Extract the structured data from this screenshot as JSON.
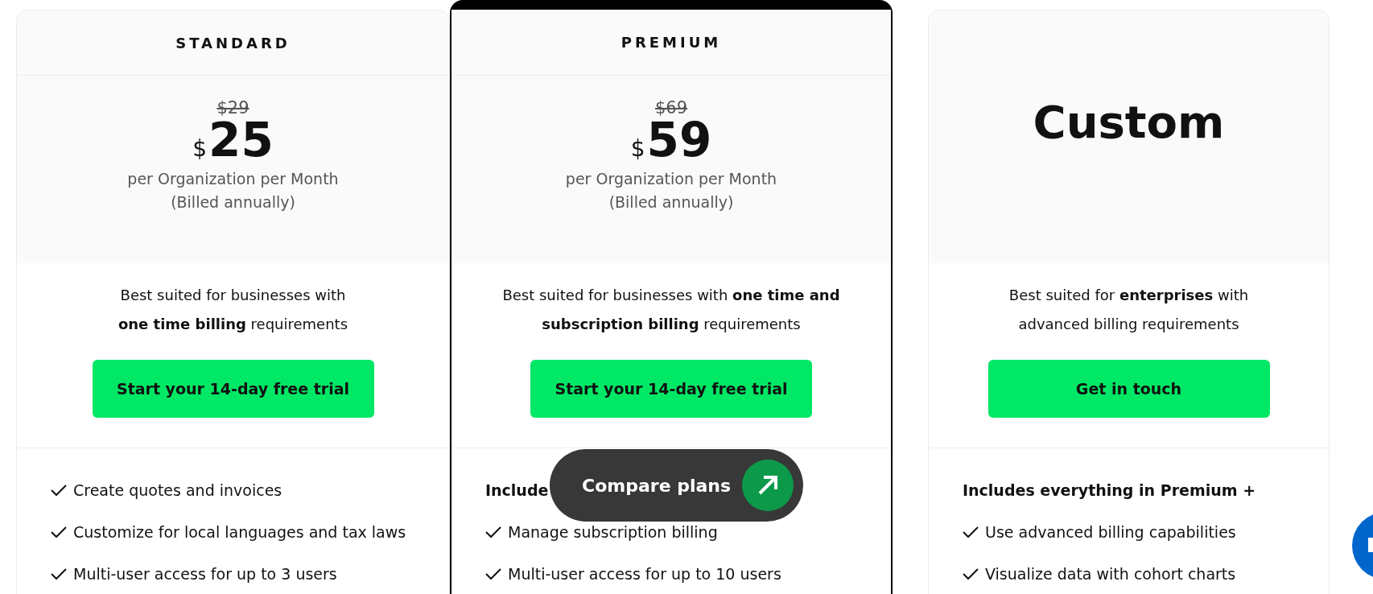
{
  "plans": [
    {
      "name": "STANDARD",
      "featured": false,
      "price": {
        "kind": "amount",
        "original": "$29",
        "currency": "$",
        "amount": "25",
        "period": "per Organization per Month",
        "billing": "(Billed annually)"
      },
      "description": "Best suited for businesses with **one time billing** requirements",
      "button": "Start your 14-day free trial",
      "features": [
        {
          "kind": "check",
          "text": "Create quotes and invoices"
        },
        {
          "kind": "check",
          "text": "Customize for local languages and tax laws"
        },
        {
          "kind": "check",
          "text": "Multi-user access for up to 3 users"
        }
      ]
    },
    {
      "name": "PREMIUM",
      "featured": true,
      "price": {
        "kind": "amount",
        "original": "$69",
        "currency": "$",
        "amount": "59",
        "period": "per Organization per Month",
        "billing": "(Billed annually)"
      },
      "description": "Best suited for businesses with **one time and subscription billing** requirements",
      "button": "Start your 14-day free trial",
      "features": [
        {
          "kind": "heading",
          "text": "Include"
        },
        {
          "kind": "check",
          "text": "Manage subscription billing"
        },
        {
          "kind": "check",
          "text": "Multi-user access for up to 10 users"
        }
      ]
    },
    {
      "featured": false,
      "price": {
        "kind": "custom",
        "amount": "Custom"
      },
      "description": "Best suited for **enterprises** with advanced billing requirements",
      "button": "Get in touch",
      "features": [
        {
          "kind": "heading",
          "text": "Includes everything in Premium +"
        },
        {
          "kind": "check",
          "text": "Use advanced billing capabilities"
        },
        {
          "kind": "check",
          "text": "Visualize data with cohort charts"
        }
      ]
    }
  ],
  "compare_button": "Compare plans"
}
